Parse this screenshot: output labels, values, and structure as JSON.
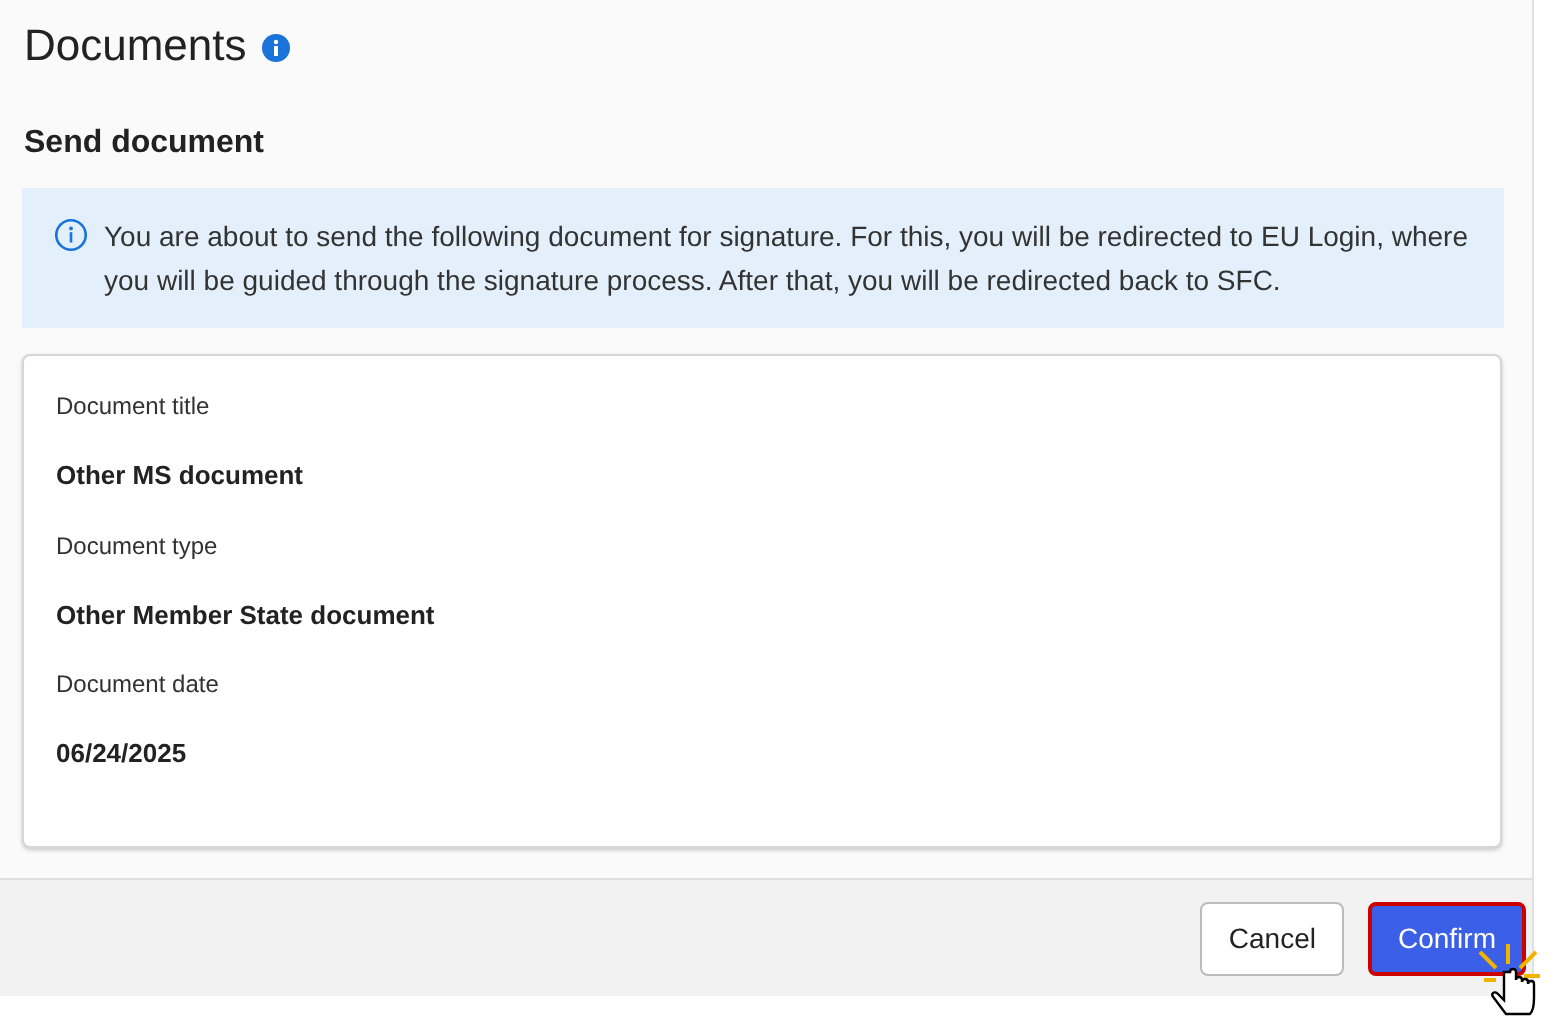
{
  "page": {
    "title": "Documents"
  },
  "section": {
    "title": "Send document"
  },
  "info": {
    "text": "You are about to send the following document for signature. For this, you will be redirected to EU Login, where you will be guided through the signature process. After that, you will be redirected back to SFC."
  },
  "fields": [
    {
      "label": "Document title",
      "value": "Other MS document"
    },
    {
      "label": "Document type",
      "value": "Other Member State document"
    },
    {
      "label": "Document date",
      "value": "06/24/2025"
    }
  ],
  "buttons": [
    {
      "label": "Cancel",
      "kind": "secondary",
      "highlighted": false
    },
    {
      "label": "Confirm",
      "kind": "primary",
      "highlighted": true
    }
  ]
}
